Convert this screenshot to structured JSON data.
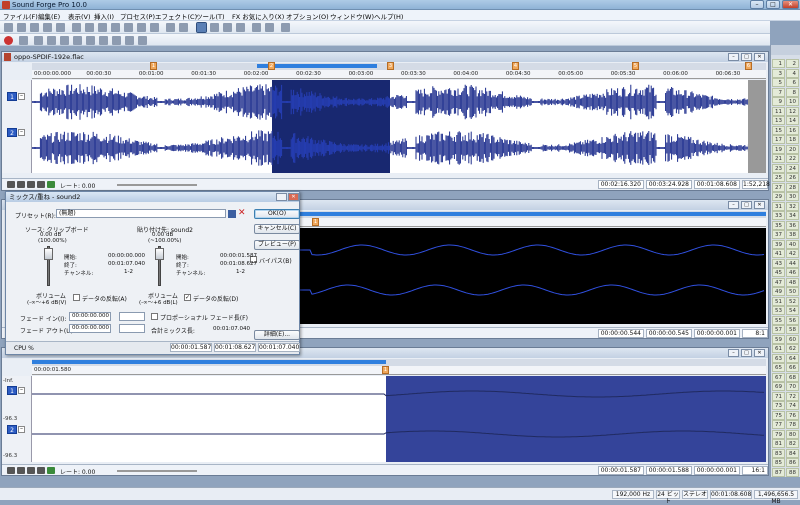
{
  "app": {
    "title": "Sound Forge Pro 10.0"
  },
  "window_controls": {
    "minimize": "–",
    "maximize": "□",
    "close": "✕"
  },
  "menu": [
    "ファイル(F)",
    "編集(E)",
    "表示(V)",
    "挿入(I)",
    "プロセス(P)",
    "エフェクト(C)",
    "ツール(T)",
    "FX お気に入り(X)",
    "オプション(O)",
    "ウィンドウ(W)",
    "ヘルプ(H)"
  ],
  "window1": {
    "title": "oppo-SPDIF-192e.flac",
    "ruler_ticks": [
      "00:00:00.000",
      "00:00:30",
      "00:01:00",
      "00:01:30",
      "00:02:00",
      "00:02:30",
      "00:03:00",
      "00:03:30",
      "00:04:00",
      "00:04:30",
      "00:05:00",
      "00:05:30",
      "00:06:00",
      "00:06:30"
    ],
    "markers": [
      "1",
      "2",
      "3",
      "4",
      "5",
      "6"
    ],
    "channels": [
      "1",
      "2"
    ],
    "rate_label": "レート: 0.00",
    "status": [
      "00:02:16.320",
      "00:03:24.928",
      "00:01:08.608",
      "1:52,218"
    ]
  },
  "window2": {
    "status": [
      "00:00:00.544",
      "00:00:00.545",
      "00:00:00.001",
      "8:1"
    ]
  },
  "window3": {
    "ruler_start": "00:00:01.580",
    "db_labels": [
      "-Inf.",
      "-96.3",
      "-Inf.",
      "-96.3"
    ],
    "channels": [
      "1",
      "2"
    ],
    "rate_label": "レート: 0.00",
    "status": [
      "00:00:01.587",
      "00:00:01.588",
      "00:00:00.001",
      "16:1"
    ]
  },
  "mix_dialog": {
    "title": "ミックス/重ね - sound2",
    "preset_label": "プリセット(R):",
    "preset_value": "(無題)",
    "buttons": {
      "ok": "OK(O)",
      "cancel": "キャンセル(C)",
      "preview": "プレビュー(P)",
      "details": "詳細(E)..."
    },
    "bypass": "バイパス(B)",
    "source": {
      "header": "ソース: クリップボード",
      "db": "0.00 dB",
      "pct": "(100.00%)",
      "start_label": "開始:",
      "start": "00:00:00.000",
      "end_label": "終了:",
      "end": "00:01:07.040",
      "channel_label": "チャンネル:",
      "channel": "1-2",
      "volume_label": "ボリューム",
      "volume_range": "(-∞〜+6 dB(V)",
      "invert_label": "データの反転(A)",
      "invert_checked": false
    },
    "dest": {
      "header": "貼り付け先: sound2",
      "db": "0.00 dB",
      "pct": "(~100.00%)",
      "start_label": "開始:",
      "start": "00:00:01.587",
      "end_label": "終了:",
      "end": "00:01:08.627",
      "channel_label": "チャンネル:",
      "channel": "1-2",
      "volume_label": "ボリューム",
      "volume_range": "(-∞〜+6 dB(L)",
      "invert_label": "データの反転(D)",
      "invert_checked": true
    },
    "fade_in_label": "フェード イン(I):",
    "fade_in_value": "00:00:00.000",
    "fade_out_label": "フェード アウト(U):",
    "fade_out_value": "00:00:00.000",
    "proportional_label": "プロポーショナル フェード長(F)",
    "total_label": "合計ミックス長:",
    "total_value": "00:01:07.040",
    "status": {
      "cpu": "CPU %",
      "a": "00:00:01.587",
      "b": "00:01:08.627",
      "c": "00:01:07.040"
    }
  },
  "right_panel_numbers": [
    "1",
    "3",
    "5",
    "7",
    "9",
    "11",
    "13",
    "15",
    "17",
    "19",
    "21",
    "23",
    "25",
    "27",
    "29",
    "31",
    "33",
    "35",
    "37",
    "39",
    "41",
    "43",
    "45",
    "47",
    "49",
    "51",
    "53",
    "55",
    "57",
    "59",
    "61",
    "63",
    "65",
    "67",
    "69",
    "71",
    "73",
    "75",
    "77",
    "79",
    "81",
    "83",
    "85",
    "87"
  ],
  "right_panel_numbers_b": [
    "2",
    "4",
    "6",
    "8",
    "10",
    "12",
    "14",
    "16",
    "18",
    "20",
    "22",
    "24",
    "26",
    "28",
    "30",
    "32",
    "34",
    "36",
    "38",
    "40",
    "42",
    "44",
    "46",
    "48",
    "50",
    "52",
    "54",
    "56",
    "58",
    "60",
    "62",
    "64",
    "66",
    "68",
    "70",
    "72",
    "74",
    "76",
    "78",
    "80",
    "82",
    "84",
    "86",
    "88"
  ],
  "statusbar": [
    "192,000 Hz",
    "24 ビット",
    "ステレオ",
    "00:01:08.608",
    "1,496,656.5 MB"
  ],
  "colors": {
    "wave": "#1c2c8c",
    "selection_bg": "#000000",
    "selection_wave": "#3050e0",
    "selected_region": "#34449a"
  }
}
